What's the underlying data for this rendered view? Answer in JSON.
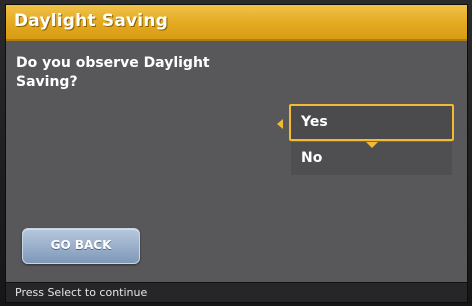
{
  "title": "Daylight Saving",
  "question": "Do you observe Daylight Saving?",
  "options": [
    {
      "label": "Yes",
      "selected": true
    },
    {
      "label": "No",
      "selected": false
    }
  ],
  "go_back_label": "GO BACK",
  "status_text": "Press Select to continue",
  "colors": {
    "accent": "#f2bb33",
    "title_bar": "#e3a91f",
    "screen_bg": "#58585a",
    "button_blue": "#7f98b9"
  },
  "icons": {
    "selection_left": "caret-left-icon",
    "scroll_down": "caret-down-icon"
  }
}
